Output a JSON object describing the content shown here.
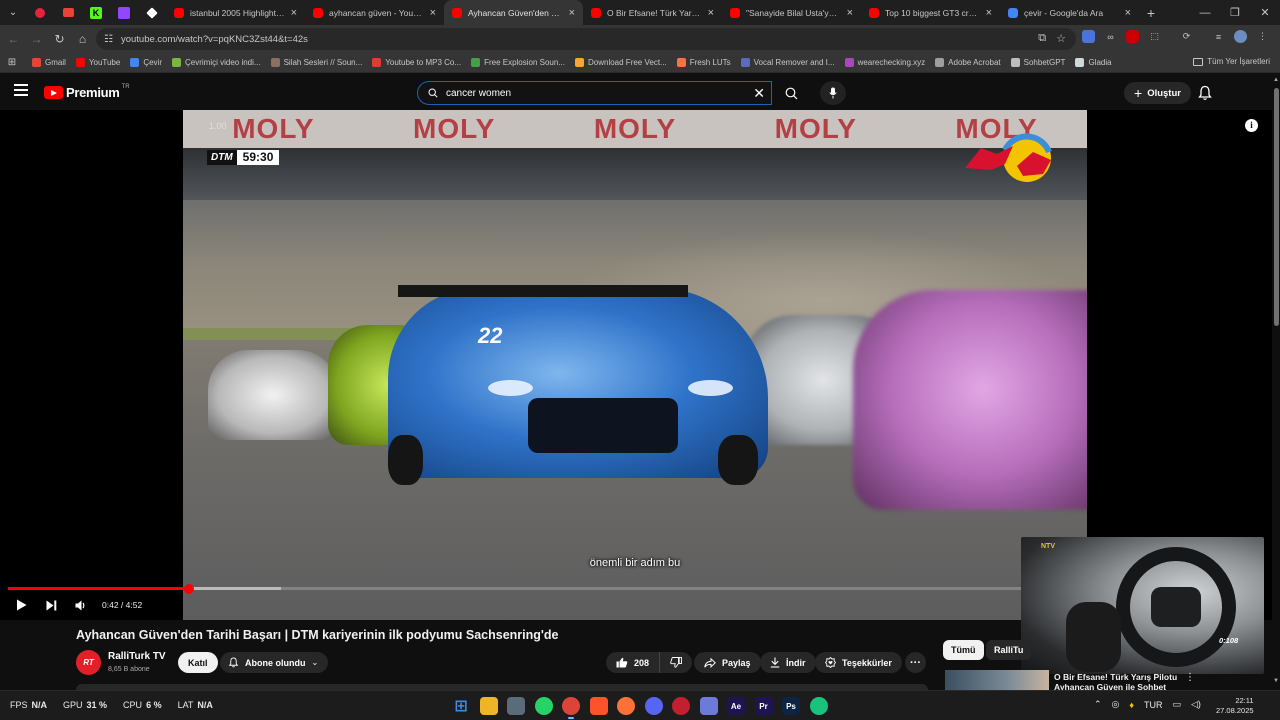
{
  "browser": {
    "tabs": [
      {
        "title": "istanbul 2005 Highlights | Pa",
        "fav": "#ff0000"
      },
      {
        "title": "ayhancan güven - YouTube",
        "fav": "#ff0000"
      },
      {
        "title": "Ayhancan Güven'den Tarihi B",
        "fav": "#ff0000",
        "active": true
      },
      {
        "title": "O Bir Efsane! Türk Yarış P",
        "fav": "#ff0000"
      },
      {
        "title": "\"Sanayide Bilal Usta'ya Çırak",
        "fav": "#ff0000"
      },
      {
        "title": "Top 10 biggest GT3 crashes",
        "fav": "#ff0000"
      },
      {
        "title": "çevir - Google'da Ara",
        "fav": "#4285f4"
      }
    ],
    "url": "youtube.com/watch?v=pqKNC3Zst44&t=42s",
    "bookmarks": [
      {
        "label": "Gmail",
        "color": "#ea4335"
      },
      {
        "label": "YouTube",
        "color": "#ff0000"
      },
      {
        "label": "Çevir",
        "color": "#4285f4"
      },
      {
        "label": "Çevrimiçi video indi...",
        "color": "#7cb342"
      },
      {
        "label": "Silah Sesleri // Soun...",
        "color": "#8d6e63"
      },
      {
        "label": "Youtube to MP3 Co...",
        "color": "#e53935"
      },
      {
        "label": "Free Explosion Soun...",
        "color": "#43a047"
      },
      {
        "label": "Download Free Vect...",
        "color": "#f9a825"
      },
      {
        "label": "Fresh LUTs",
        "color": "#ff7043"
      },
      {
        "label": "Vocal Remover and I...",
        "color": "#5c6bc0"
      },
      {
        "label": "wearechecking.xyz",
        "color": "#ab47bc"
      },
      {
        "label": "Adobe Acrobat",
        "color": "#9e9e9e"
      },
      {
        "label": "SohbetGPT",
        "color": "#bdbdbd"
      },
      {
        "label": "Gladia",
        "color": "#cfd8dc"
      }
    ],
    "all_bookmarks": "Tüm Yer İşaretleri"
  },
  "youtube": {
    "logo_word": "Premium",
    "logo_region": "TR",
    "search_value": "cancer women",
    "create_label": "Oluştur"
  },
  "player": {
    "speed_badge": "1.00",
    "dtm_logo": "DTM",
    "dtm_time": "59:30",
    "sponsor_text": "MOLY",
    "car_number": "22",
    "caption": "önemli bir adım bu",
    "time_current": "0:42",
    "time_total": "4:52",
    "played_fraction": 0.144,
    "loaded_fraction": 0.217,
    "pip_channel": "NTV",
    "pip_display": "0:108"
  },
  "video": {
    "title": "Ayhancan Güven'den Tarihi Başarı | DTM kariyerinin ilk podyumu Sachsenring'de",
    "channel_name": "RalliTurk TV",
    "channel_avatar_text": "RT",
    "subscribers": "8,65 B abone",
    "join_label": "Katıl",
    "subscribed_label": "Abone olundu",
    "like_count": "208",
    "share_label": "Paylaş",
    "download_label": "İndir",
    "thanks_label": "Teşekkürler"
  },
  "sidebar": {
    "chip_all": "Tümü",
    "chip_channel": "RalliTu",
    "rec_title": "O Bir Efsane! Türk Yarış Pilotu Ayhancan Güven ile Sohbet"
  },
  "taskbar": {
    "fps_label": "FPS",
    "fps_value": "N/A",
    "gpu_label": "GPU",
    "gpu_value": "31 %",
    "cpu_label": "CPU",
    "cpu_value": "6 %",
    "lat_label": "LAT",
    "lat_value": "N/A",
    "language": "TUR",
    "time": "22:11",
    "date": "27.08.2025",
    "apps": [
      {
        "name": "windows-start",
        "color": "#3a8ee6",
        "glyph": "⊞"
      },
      {
        "name": "file-explorer",
        "color": "#f0b429",
        "glyph": ""
      },
      {
        "name": "notepad",
        "color": "#5b6b7a",
        "glyph": ""
      },
      {
        "name": "whatsapp",
        "color": "#25d366",
        "glyph": ""
      },
      {
        "name": "chrome",
        "color": "#db4437",
        "glyph": "",
        "active": true
      },
      {
        "name": "brave",
        "color": "#fb542b",
        "glyph": ""
      },
      {
        "name": "firefox",
        "color": "#ff7139",
        "glyph": ""
      },
      {
        "name": "discord",
        "color": "#5865f2",
        "glyph": ""
      },
      {
        "name": "opera",
        "color": "#c21f30",
        "glyph": ""
      },
      {
        "name": "vpn",
        "color": "#6c7bd9",
        "glyph": ""
      },
      {
        "name": "after-effects",
        "color": "#1f1452",
        "glyph": "Ae"
      },
      {
        "name": "premiere",
        "color": "#1f1452",
        "glyph": "Pr"
      },
      {
        "name": "photoshop",
        "color": "#0b2542",
        "glyph": "Ps"
      },
      {
        "name": "chatgpt",
        "color": "#19c37d",
        "glyph": ""
      }
    ]
  }
}
